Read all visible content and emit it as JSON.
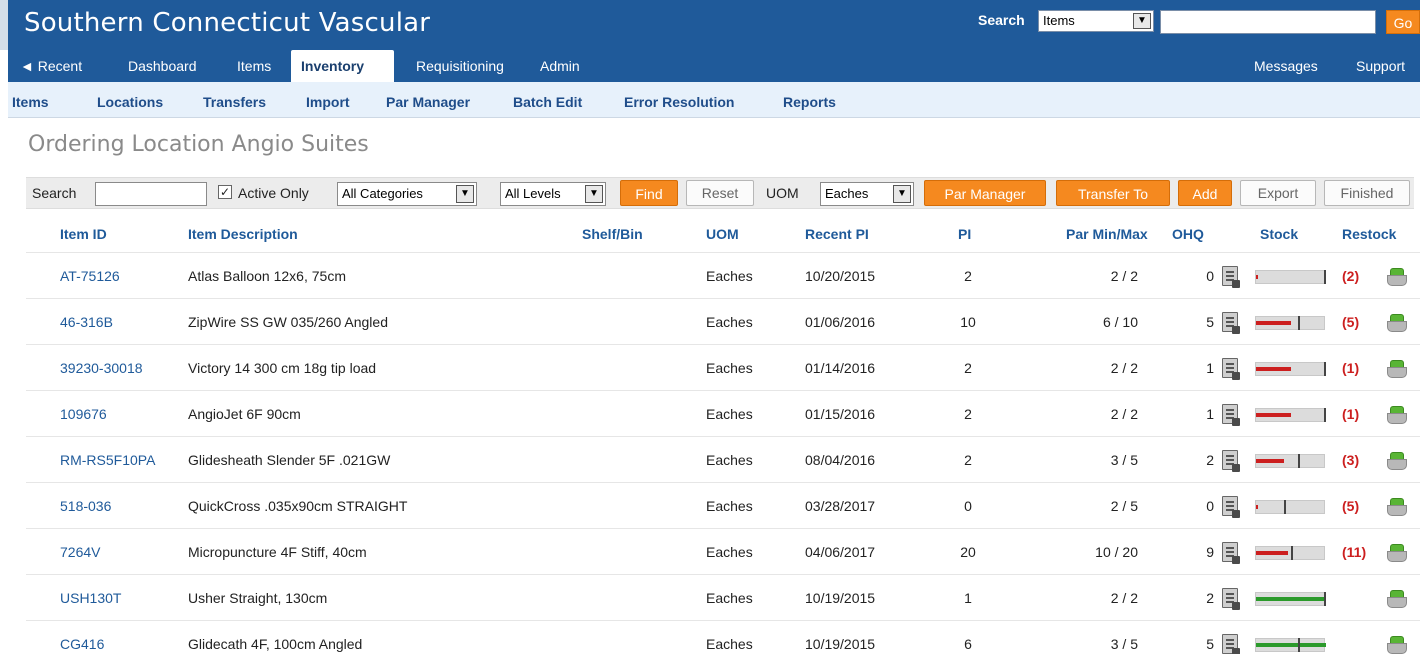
{
  "app": {
    "title": "Southern Connecticut Vascular",
    "search_label": "Search",
    "search_scope": "Items",
    "search_value": "",
    "go_label": "Go"
  },
  "mainnav": {
    "recent": "◄ Recent",
    "items": [
      "Dashboard",
      "Items",
      "Inventory",
      "Requisitioning",
      "Admin"
    ],
    "active": "Inventory",
    "right": [
      "Messages",
      "Support"
    ]
  },
  "subnav": {
    "items": [
      "Items",
      "Locations",
      "Transfers",
      "Import",
      "Par Manager",
      "Batch Edit",
      "Error Resolution",
      "Reports"
    ]
  },
  "page": {
    "title": "Ordering Location Angio Suites"
  },
  "toolbar": {
    "search_label": "Search",
    "search_value": "",
    "active_only_label": "Active Only",
    "active_only_checked": true,
    "category": "All Categories",
    "level": "All Levels",
    "find": "Find",
    "reset": "Reset",
    "uom_label": "UOM",
    "uom": "Eaches",
    "par_manager": "Par Manager",
    "transfer_to": "Transfer To",
    "add": "Add",
    "export": "Export",
    "finished": "Finished"
  },
  "colors": {
    "brand": "#1f5a9a",
    "accent": "#f5891f",
    "low": "#cc1f1f",
    "ok": "#2b9a2b"
  },
  "table": {
    "headers": [
      "Item ID",
      "Item Description",
      "Shelf/Bin",
      "UOM",
      "Recent PI",
      "PI",
      "Par Min/Max",
      "OHQ",
      "Stock",
      "Restock"
    ],
    "rows": [
      {
        "id": "AT-75126",
        "desc": "Atlas Balloon 12x6, 75cm",
        "shelf": "",
        "uom": "Eaches",
        "recent_pi": "10/20/2015",
        "pi": "2",
        "par": "2 / 2",
        "ohq": "0",
        "restock": "(2)",
        "stock_level": 0.0,
        "stock_min": 1.0,
        "stock_state": "low"
      },
      {
        "id": "46-316B",
        "desc": "ZipWire SS GW 035/260 Angled",
        "shelf": "",
        "uom": "Eaches",
        "recent_pi": "01/06/2016",
        "pi": "10",
        "par": "6 / 10",
        "ohq": "5",
        "restock": "(5)",
        "stock_level": 0.5,
        "stock_min": 0.6,
        "stock_state": "low"
      },
      {
        "id": "39230-30018",
        "desc": "Victory 14 300 cm 18g tip load",
        "shelf": "",
        "uom": "Eaches",
        "recent_pi": "01/14/2016",
        "pi": "2",
        "par": "2 / 2",
        "ohq": "1",
        "restock": "(1)",
        "stock_level": 0.5,
        "stock_min": 1.0,
        "stock_state": "low"
      },
      {
        "id": "109676",
        "desc": "AngioJet 6F 90cm",
        "shelf": "",
        "uom": "Eaches",
        "recent_pi": "01/15/2016",
        "pi": "2",
        "par": "2 / 2",
        "ohq": "1",
        "restock": "(1)",
        "stock_level": 0.5,
        "stock_min": 1.0,
        "stock_state": "low"
      },
      {
        "id": "RM-RS5F10PA",
        "desc": "Glidesheath Slender 5F .021GW",
        "shelf": "",
        "uom": "Eaches",
        "recent_pi": "08/04/2016",
        "pi": "2",
        "par": "3 / 5",
        "ohq": "2",
        "restock": "(3)",
        "stock_level": 0.4,
        "stock_min": 0.6,
        "stock_state": "low"
      },
      {
        "id": "518-036",
        "desc": "QuickCross .035x90cm STRAIGHT",
        "shelf": "",
        "uom": "Eaches",
        "recent_pi": "03/28/2017",
        "pi": "0",
        "par": "2 / 5",
        "ohq": "0",
        "restock": "(5)",
        "stock_level": 0.0,
        "stock_min": 0.4,
        "stock_state": "low"
      },
      {
        "id": "7264V",
        "desc": "Micropuncture 4F Stiff, 40cm",
        "shelf": "",
        "uom": "Eaches",
        "recent_pi": "04/06/2017",
        "pi": "20",
        "par": "10 / 20",
        "ohq": "9",
        "restock": "(11)",
        "stock_level": 0.45,
        "stock_min": 0.5,
        "stock_state": "low"
      },
      {
        "id": "USH130T",
        "desc": "Usher Straight, 130cm",
        "shelf": "",
        "uom": "Eaches",
        "recent_pi": "10/19/2015",
        "pi": "1",
        "par": "2 / 2",
        "ohq": "2",
        "restock": "",
        "stock_level": 1.0,
        "stock_min": 1.0,
        "stock_state": "ok"
      },
      {
        "id": "CG416",
        "desc": "Glidecath 4F, 100cm Angled",
        "shelf": "",
        "uom": "Eaches",
        "recent_pi": "10/19/2015",
        "pi": "6",
        "par": "3 / 5",
        "ohq": "5",
        "restock": "",
        "stock_level": 1.0,
        "stock_min": 0.6,
        "stock_state": "ok"
      }
    ]
  }
}
